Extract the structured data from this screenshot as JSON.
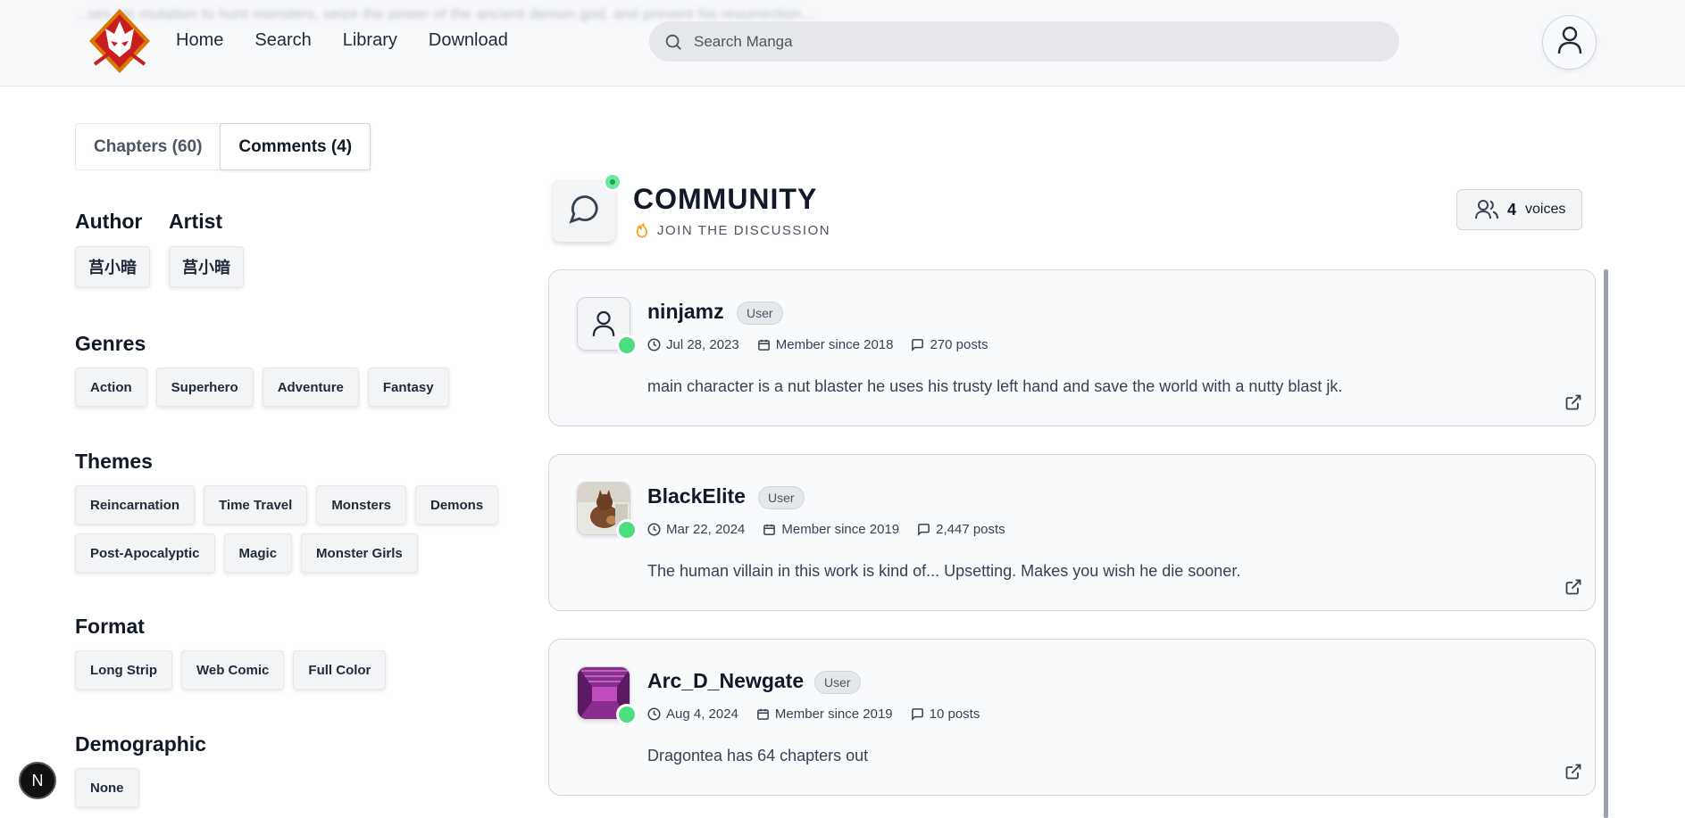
{
  "header": {
    "blurred_text": "...ses his mutation to hunt monsters, seize the power of the ancient demon god, and prevent his resurrection...",
    "nav": [
      "Home",
      "Search",
      "Library",
      "Download"
    ],
    "search_placeholder": "Search Manga"
  },
  "tabs": {
    "chapters": "Chapters (60)",
    "comments": "Comments (4)"
  },
  "sidebar": {
    "author_title": "Author",
    "author": "莒小暗",
    "artist_title": "Artist",
    "artist": "莒小暗",
    "genres_title": "Genres",
    "genres": [
      "Action",
      "Superhero",
      "Adventure",
      "Fantasy"
    ],
    "themes_title": "Themes",
    "themes": [
      "Reincarnation",
      "Time Travel",
      "Monsters",
      "Demons",
      "Post-Apocalyptic",
      "Magic",
      "Monster Girls"
    ],
    "format_title": "Format",
    "format": [
      "Long Strip",
      "Web Comic",
      "Full Color"
    ],
    "demographic_title": "Demographic",
    "demographic": [
      "None"
    ]
  },
  "community": {
    "title": "COMMUNITY",
    "subtitle": "JOIN THE DISCUSSION",
    "voices_count": "4",
    "voices_label": "voices"
  },
  "comments": [
    {
      "username": "ninjamz",
      "role": "User",
      "date": "Jul 28, 2023",
      "member_since": "Member since 2018",
      "posts": "270 posts",
      "text": "main character is a nut blaster he uses his trusty left hand and save the world with a nutty blast jk.",
      "avatar": "default-user-icon"
    },
    {
      "username": "BlackElite",
      "role": "User",
      "date": "Mar 22, 2024",
      "member_since": "Member since 2019",
      "posts": "2,447 posts",
      "text": "The human villain in this work is kind of... Upsetting. Makes you wish he die sooner.",
      "avatar": "cat-photo"
    },
    {
      "username": "Arc_D_Newgate",
      "role": "User",
      "date": "Aug 4, 2024",
      "member_since": "Member since 2019",
      "posts": "10 posts",
      "text": "Dragontea has 64 chapters out",
      "avatar": "purple-corridor-art"
    }
  ],
  "fab_label": "N",
  "colors": {
    "online": "#4ade80",
    "accent_flame": "#f59e0b",
    "logo_red": "#c81e1e"
  }
}
